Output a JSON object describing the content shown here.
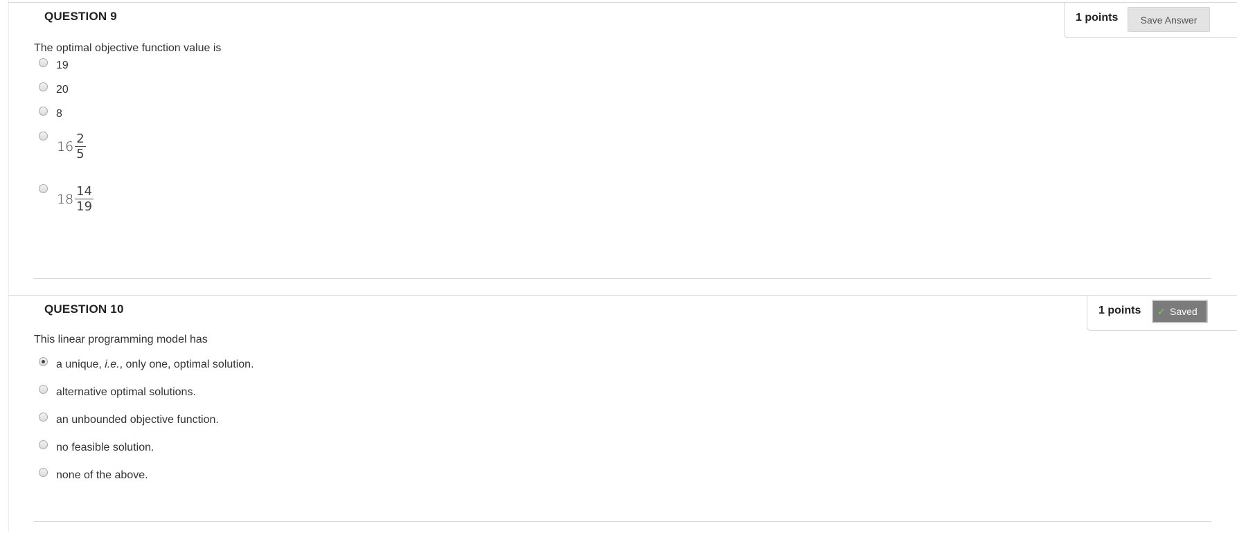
{
  "question9": {
    "title": "QUESTION 9",
    "points": "1 points",
    "save_label": "Save Answer",
    "prompt": "The optimal objective function value is",
    "options": [
      {
        "label": "19",
        "selected": false
      },
      {
        "label": "20",
        "selected": false
      },
      {
        "label": "8",
        "selected": false
      },
      {
        "whole": "16",
        "numerator": "2",
        "denominator": "5",
        "selected": false
      },
      {
        "whole": "18",
        "numerator": "14",
        "denominator": "19",
        "selected": false
      }
    ]
  },
  "question10": {
    "title": "QUESTION 10",
    "points": "1 points",
    "saved_label": "Saved",
    "saved_icon": "check-icon",
    "prompt": "This linear programming model has",
    "options": [
      {
        "label_pre": "a unique, ",
        "label_em": "i.e.",
        "label_post": ", only one, optimal solution.",
        "selected": true
      },
      {
        "label": "alternative optimal solutions.",
        "selected": false
      },
      {
        "label": "an unbounded objective function.",
        "selected": false
      },
      {
        "label": "no feasible solution.",
        "selected": false
      },
      {
        "label": "none of the above.",
        "selected": false
      }
    ]
  },
  "colors": {
    "saved_button_bg": "#7b7b7b",
    "check_green": "#7fd34a",
    "save_button_bg": "#e3e3e3"
  }
}
